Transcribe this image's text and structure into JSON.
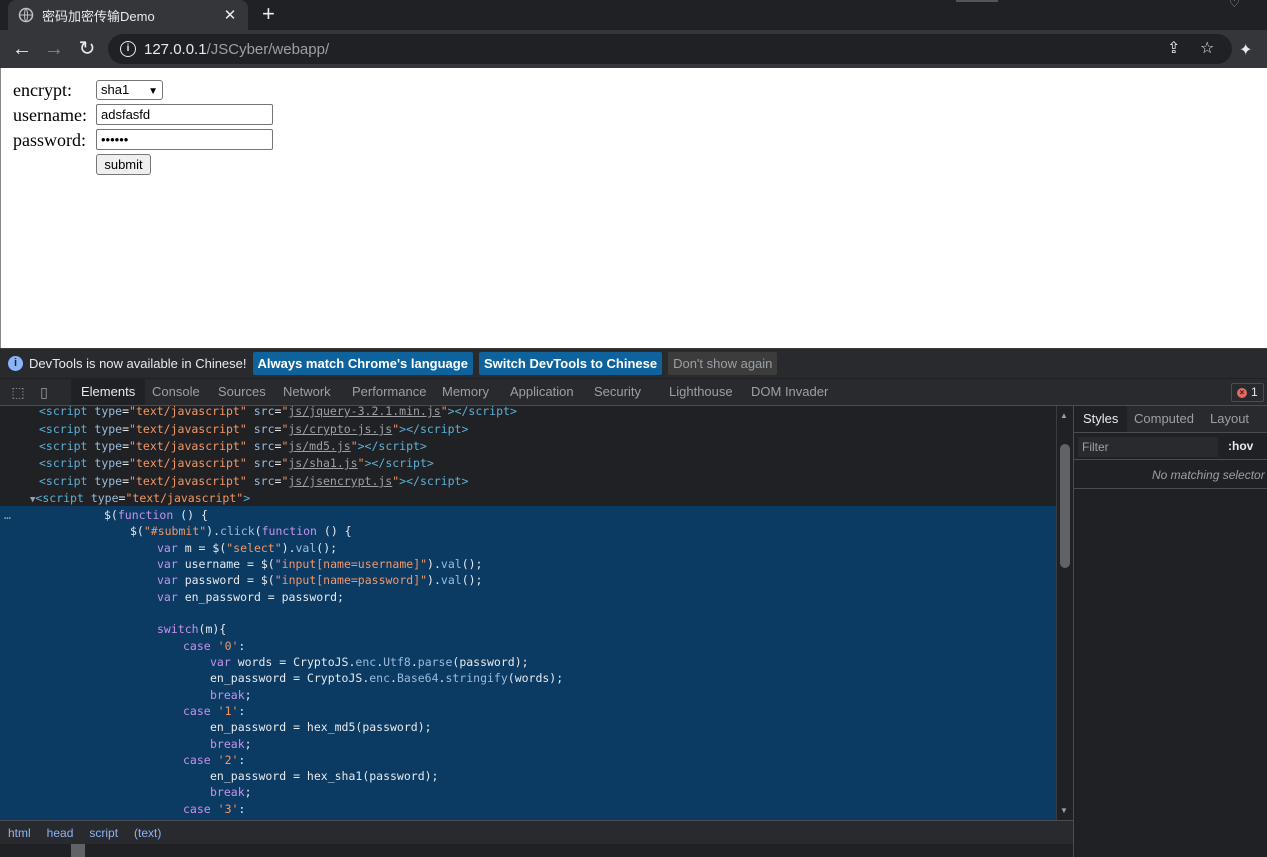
{
  "browser": {
    "tab_title": "密码加密传输Demo",
    "tab_close": "✕",
    "new_tab": "+",
    "url_host": "127.0.0.1",
    "url_path": "/JSCyber/webapp/"
  },
  "form": {
    "encrypt_label": "encrypt:",
    "encrypt_value": "sha1",
    "username_label": "username:",
    "username_value": "adsfasfd",
    "password_label": "password:",
    "password_value": "••••••",
    "submit_label": "submit"
  },
  "infobar": {
    "message": "DevTools is now available in Chinese!",
    "btn_match": "Always match Chrome's language",
    "btn_switch": "Switch DevTools to Chinese",
    "btn_dismiss": "Don't show again"
  },
  "devtools": {
    "tabs": [
      "Elements",
      "Console",
      "Sources",
      "Network",
      "Performance",
      "Memory",
      "Application",
      "Security",
      "Lighthouse",
      "DOM Invader"
    ],
    "error_count": "1",
    "breadcrumb": [
      "html",
      "head",
      "script",
      "(text)"
    ],
    "side_tabs": [
      "Styles",
      "Computed",
      "Layout"
    ],
    "filter_placeholder": "Filter",
    "hov": ":hov",
    "no_match": "No matching selector"
  },
  "source": {
    "script_srcs": [
      "js/jquery-3.2.1.min.js",
      "js/crypto-js.js",
      "js/md5.js",
      "js/sha1.js",
      "js/jsencrypt.js"
    ],
    "script_type": "text/javascript"
  }
}
